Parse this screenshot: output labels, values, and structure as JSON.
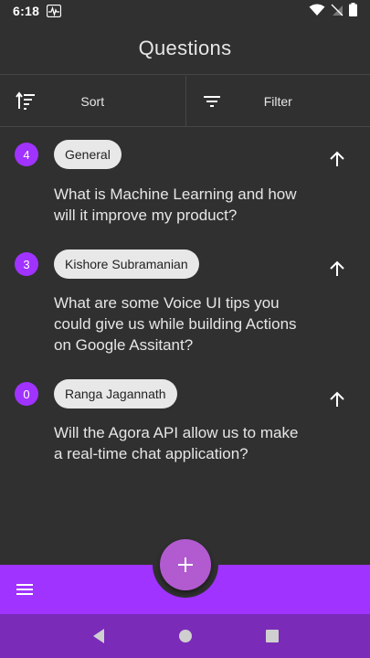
{
  "status_bar": {
    "time": "6:18",
    "icons": [
      "activity-icon",
      "wifi-icon",
      "no-sim-icon",
      "battery-icon"
    ]
  },
  "header": {
    "title": "Questions"
  },
  "toolbar": {
    "sort_label": "Sort",
    "sort_icon": "sort-icon",
    "filter_label": "Filter",
    "filter_icon": "filter-icon"
  },
  "questions": [
    {
      "count": "4",
      "author": "General",
      "text": "What is Machine Learning and how will it improve my product?"
    },
    {
      "count": "3",
      "author": "Kishore Subramanian",
      "text": "What are some Voice UI tips you could give us while building Actions on Google Assitant?"
    },
    {
      "count": "0",
      "author": "Ranga Jagannath",
      "text": "Will the Agora API allow us to make a real-time chat application?"
    }
  ],
  "fab": {
    "icon": "plus-icon"
  },
  "bottom_bar": {
    "icon": "menu-icon"
  },
  "nav_bar": {
    "icons": [
      "back-icon",
      "home-icon",
      "recents-icon"
    ]
  },
  "colors": {
    "background": "#303030",
    "accent": "#a033ff",
    "fab": "#b25bd0",
    "nav_bar": "#7a2bb8",
    "chip": "#e8e8e8"
  }
}
